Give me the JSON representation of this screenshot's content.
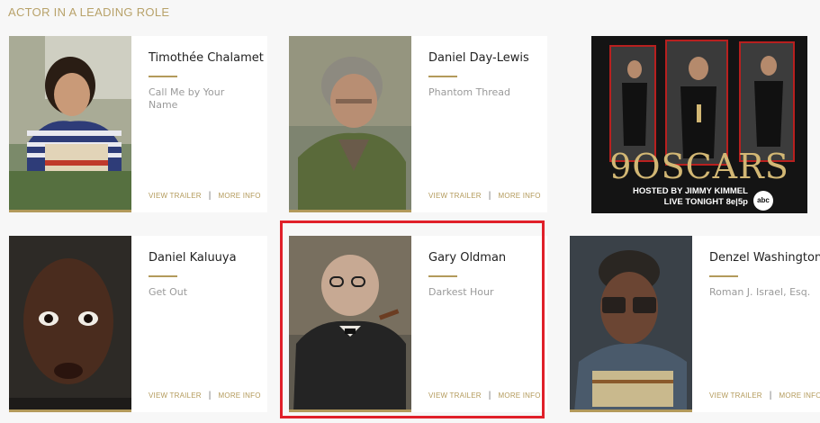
{
  "section": {
    "title": "ACTOR IN A LEADING ROLE"
  },
  "nominees": [
    {
      "name": "Timothée Chalamet",
      "film": "Call Me by Your Name",
      "trailer": "VIEW TRAILER",
      "more": "MORE INFO"
    },
    {
      "name": "Daniel Day-Lewis",
      "film": "Phantom Thread",
      "trailer": "VIEW TRAILER",
      "more": "MORE INFO"
    },
    {
      "name": "Daniel Kaluuya",
      "film": "Get Out",
      "trailer": "VIEW TRAILER",
      "more": "MORE INFO"
    },
    {
      "name": "Gary Oldman",
      "film": "Darkest Hour",
      "trailer": "VIEW TRAILER",
      "more": "MORE INFO"
    },
    {
      "name": "Denzel Washington",
      "film": "Roman J. Israel, Esq.",
      "trailer": "VIEW TRAILER",
      "more": "MORE INFO"
    }
  ],
  "ad": {
    "brand": "9OSCARS",
    "line1": "HOSTED BY JIMMY KIMMEL",
    "line2": "LIVE TONIGHT 8e|5p",
    "network": "abc"
  },
  "colors": {
    "accent": "#b39a5b",
    "highlight": "#e0202a"
  }
}
